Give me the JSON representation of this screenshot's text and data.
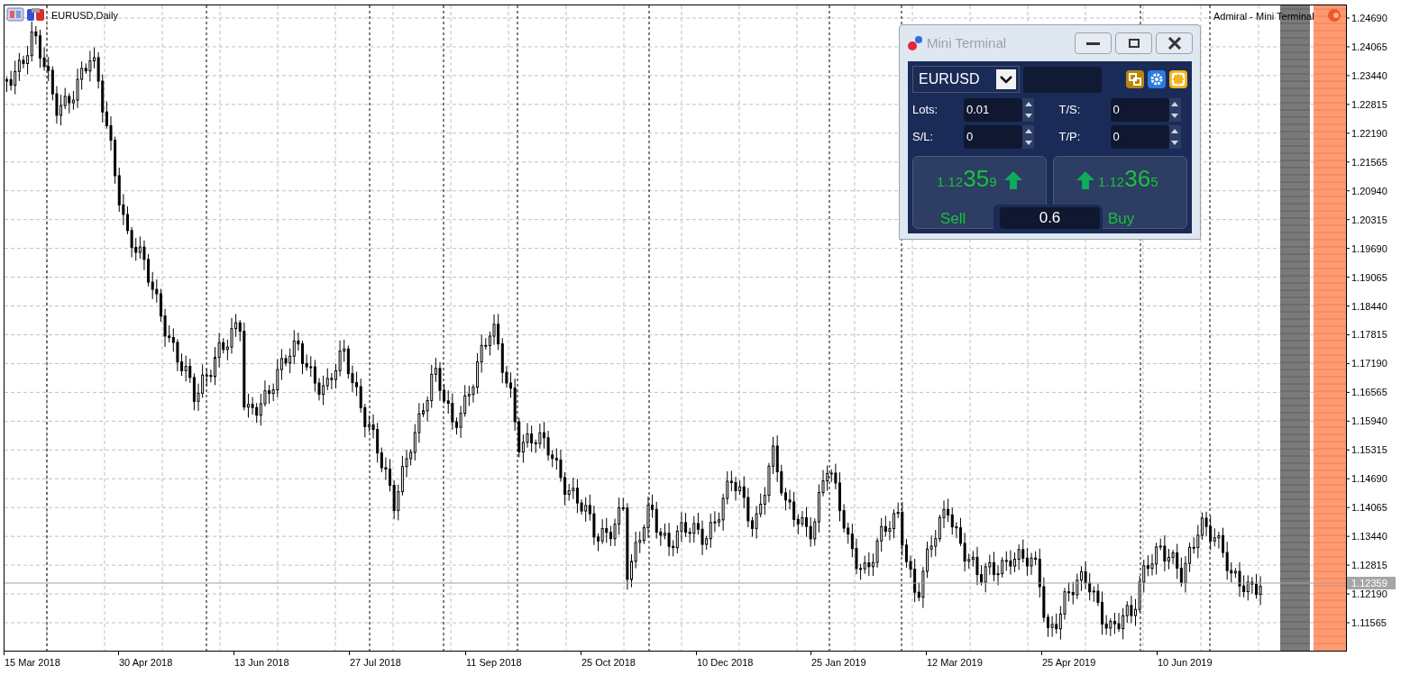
{
  "chart": {
    "title": "EURUSD,Daily",
    "overlay_label": "Admiral - Mini Terminal",
    "price_axis": [
      "1.24690",
      "1.24065",
      "1.23440",
      "1.22815",
      "1.22190",
      "1.21565",
      "1.20940",
      "1.20315",
      "1.19690",
      "1.19065",
      "1.18440",
      "1.17815",
      "1.17190",
      "1.16565",
      "1.15940",
      "1.15315",
      "1.14690",
      "1.14065",
      "1.13440",
      "1.12815",
      "1.12190",
      "1.11565"
    ],
    "current_price": "1.12359",
    "date_axis": [
      "15 Mar 2018",
      "30 Apr 2018",
      "13 Jun 2018",
      "27 Jul 2018",
      "11 Sep 2018",
      "25 Oct 2018",
      "10 Dec 2018",
      "25 Jan 2019",
      "12 Mar 2019",
      "25 Apr 2019",
      "10 Jun 2019"
    ]
  },
  "mini_terminal": {
    "title": "Mini Terminal",
    "symbol": "EURUSD",
    "fields": [
      {
        "label": "Lots:",
        "value": "0.01"
      },
      {
        "label": "T/S:",
        "value": "0"
      },
      {
        "label": "S/L:",
        "value": "0"
      },
      {
        "label": "T/P:",
        "value": "0"
      }
    ],
    "sell": {
      "prefix": "1.12",
      "big": "35",
      "suffix": "9",
      "label": "Sell"
    },
    "buy": {
      "prefix": "1.12",
      "big": "36",
      "suffix": "5",
      "label": "Buy"
    },
    "spread": "0.6"
  }
}
